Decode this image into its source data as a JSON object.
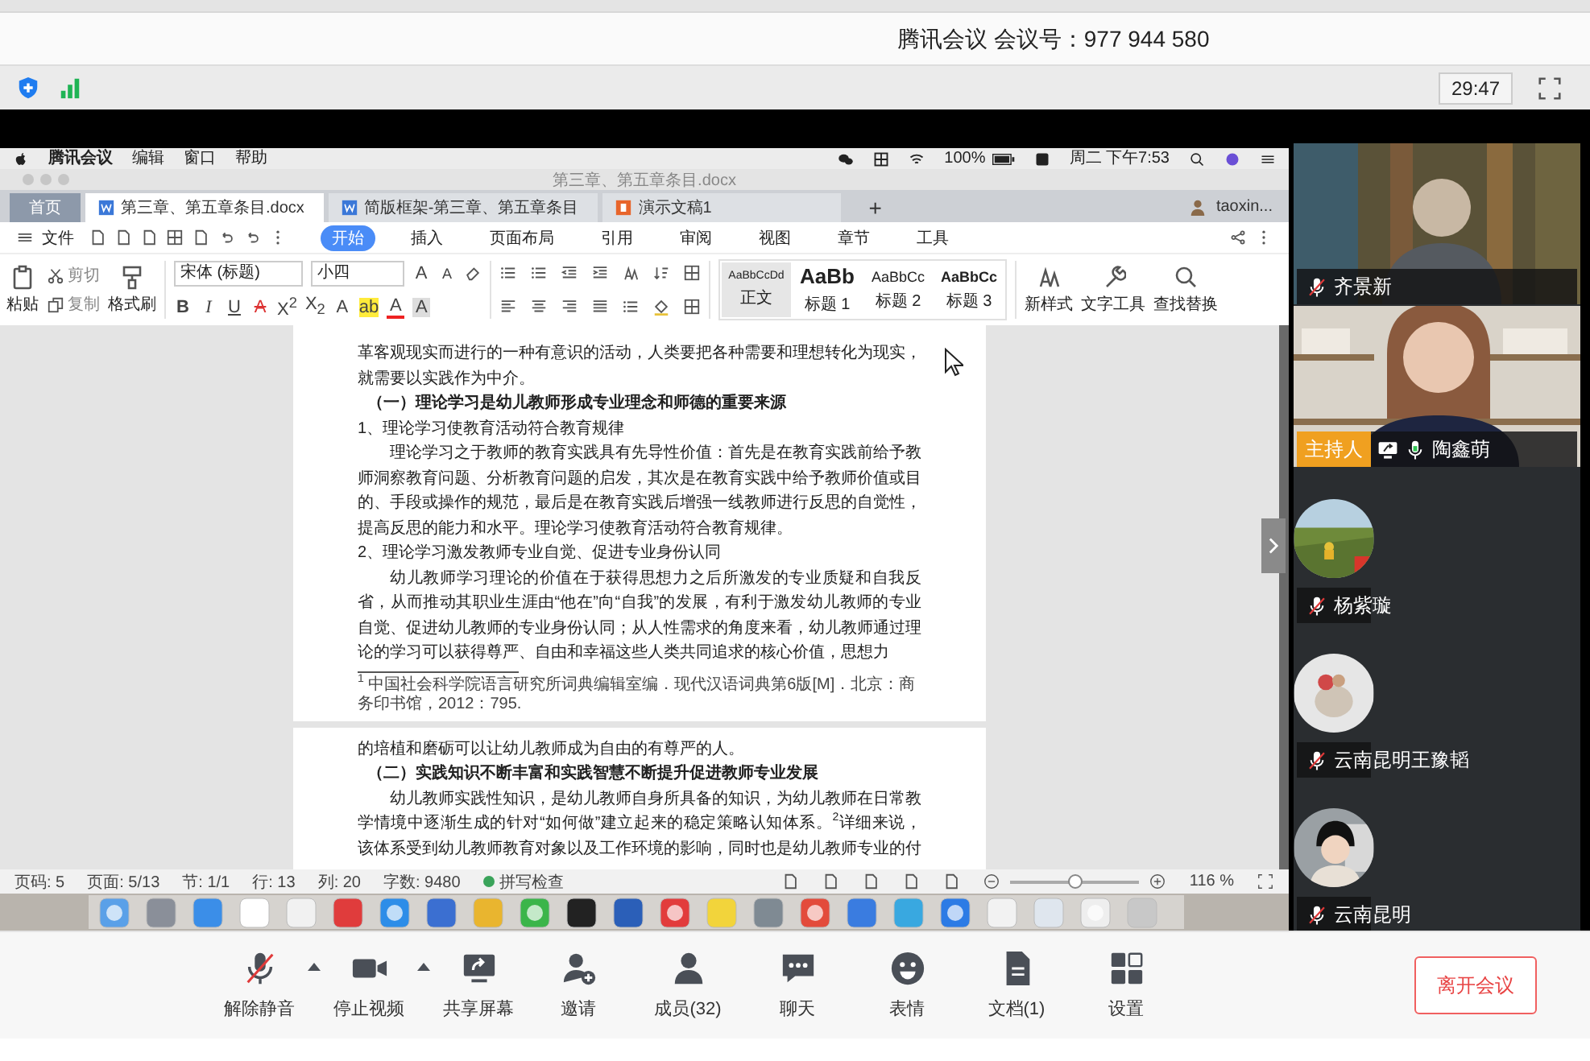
{
  "meeting_bar": {
    "title": "腾讯会议 会议号：977 944 580",
    "timer": "29:47"
  },
  "shared_screen": {
    "mac_menu": {
      "items": [
        "腾讯会议",
        "编辑",
        "窗口",
        "帮助"
      ],
      "battery": "100%",
      "clock": "周二 下午7:53"
    },
    "window_title": "第三章、第五章条目.docx",
    "tabs": [
      {
        "label": "首页",
        "kind": "home",
        "selected": false
      },
      {
        "label": "第三章、第五章条目.docx",
        "kind": "doc",
        "selected": true
      },
      {
        "label": "简版框架-第三章、第五章条目",
        "kind": "doc",
        "selected": false
      },
      {
        "label": "演示文稿1",
        "kind": "slides",
        "selected": false
      }
    ],
    "new_tab": "+",
    "user": "taoxin...",
    "file_menu": "文件",
    "menu": [
      {
        "label": "开始",
        "selected": true
      },
      {
        "label": "插入",
        "selected": false
      },
      {
        "label": "页面布局",
        "selected": false
      },
      {
        "label": "引用",
        "selected": false
      },
      {
        "label": "审阅",
        "selected": false
      },
      {
        "label": "视图",
        "selected": false
      },
      {
        "label": "章节",
        "selected": false
      },
      {
        "label": "工具",
        "selected": false
      }
    ],
    "clipboard": {
      "paste": "粘贴",
      "cut": "剪切",
      "copy": "复制",
      "painter": "格式刷"
    },
    "font": "宋体 (标题)",
    "size": "小四",
    "size_buttons": [
      "A",
      "A"
    ],
    "format_buttons": [
      "B",
      "I",
      "U",
      "A",
      "X$^{2}$",
      "X$_{2}$",
      "A",
      "ab",
      "A",
      "A"
    ],
    "styles": [
      {
        "sample": "AaBbCcDd",
        "name": "正文",
        "selected": true
      },
      {
        "sample": "AaBb",
        "name": "标题 1",
        "selected": false
      },
      {
        "sample": "AaBbCc",
        "name": "标题 2",
        "selected": false
      },
      {
        "sample": "AaBbCc",
        "name": "标题 3",
        "selected": false
      }
    ],
    "tools": [
      "新样式",
      "文字工具",
      "查找替换"
    ],
    "pages": [
      {
        "blocks": [
          {
            "kind": "text",
            "text": "革客观现实而进行的一种有意识的活动，人类要把各种需要和理想转化为现实，就需要以实践作为中介。"
          },
          {
            "kind": "heading",
            "text": "（一）理论学习是幼儿教师形成专业理念和师德的重要来源"
          },
          {
            "kind": "text",
            "text": "1、理论学习使教育活动符合教育规律"
          },
          {
            "kind": "paragraph",
            "text": "理论学习之于教师的教育实践具有先导性价值：首先是在教育实践前给予教师洞察教育问题、分析教育问题的启发，其次是在教育实践中给予教师价值或目的、手段或操作的规范，最后是在教育实践后增强一线教师进行反思的自觉性，提高反思的能力和水平。理论学习使教育活动符合教育规律。"
          },
          {
            "kind": "text",
            "text": "2、理论学习激发教师专业自觉、促进专业身份认同"
          },
          {
            "kind": "paragraph",
            "text": "幼儿教师学习理论的价值在于获得思想力之后所激发的专业质疑和自我反省，从而推动其职业生涯由“他在”向“自我”的发展，有利于激发幼儿教师的专业自觉、促进幼儿教师的专业身份认同；从人性需求的角度来看，幼儿教师通过理论的学习可以获得尊严、自由和幸福这些人类共同追求的核心价值，思想力"
          }
        ],
        "footnote": "$^{1}$ 中国社会科学院语言研究所词典编辑室编．现代汉语词典第6版[M]．北京：商务印书馆，2012：795."
      },
      {
        "blocks": [
          {
            "kind": "text",
            "text": "的培植和磨砺可以让幼儿教师成为自由的有尊严的人。"
          },
          {
            "kind": "heading",
            "text": "（二）实践知识不断丰富和实践智慧不断提升促进教师专业发展"
          },
          {
            "kind": "paragraph",
            "text": "幼儿教师实践性知识，是幼儿教师自身所具备的知识，为幼儿教师在日常教学情境中逐渐生成的针对“如何做”建立起来的稳定策略认知体系。$^{2}$详细来说，该体系受到幼儿教师教育对象以及工作环境的影响，同时也是幼儿教师专业的付"
          }
        ]
      }
    ],
    "status": {
      "items": [
        "页码: 5",
        "页面: 5/13",
        "节: 1/1",
        "行: 13",
        "列: 20",
        "字数: 9480"
      ],
      "spell": "拼写检查",
      "zoom": "116 %",
      "level": 0.5
    }
  },
  "participants": [
    {
      "name": "齐景新",
      "kind": "video",
      "muted": true
    },
    {
      "name": "陶鑫萌",
      "kind": "video",
      "muted": false,
      "host_label": "主持人",
      "sharing": true
    },
    {
      "name": "杨紫璇",
      "kind": "avatar",
      "muted": true
    },
    {
      "name": "云南昆明王豫韬",
      "kind": "avatar",
      "muted": true
    },
    {
      "name": "云南昆明",
      "kind": "avatar",
      "muted": true
    }
  ],
  "toolbar": {
    "items": [
      {
        "label": "解除静音",
        "kind": "mic",
        "muted": true,
        "caret": true
      },
      {
        "label": "停止视频",
        "kind": "video",
        "caret": true
      },
      {
        "label": "共享屏幕",
        "kind": "share",
        "caret": false
      },
      {
        "label": "邀请",
        "kind": "invite",
        "caret": false
      },
      {
        "label": "成员(32)",
        "kind": "members",
        "caret": false
      },
      {
        "label": "聊天",
        "kind": "chat",
        "caret": false
      },
      {
        "label": "表情",
        "kind": "emoji",
        "caret": false
      },
      {
        "label": "文档(1)",
        "kind": "docs",
        "caret": false
      },
      {
        "label": "设置",
        "kind": "settings",
        "caret": false
      }
    ],
    "leave": "离开会议"
  }
}
